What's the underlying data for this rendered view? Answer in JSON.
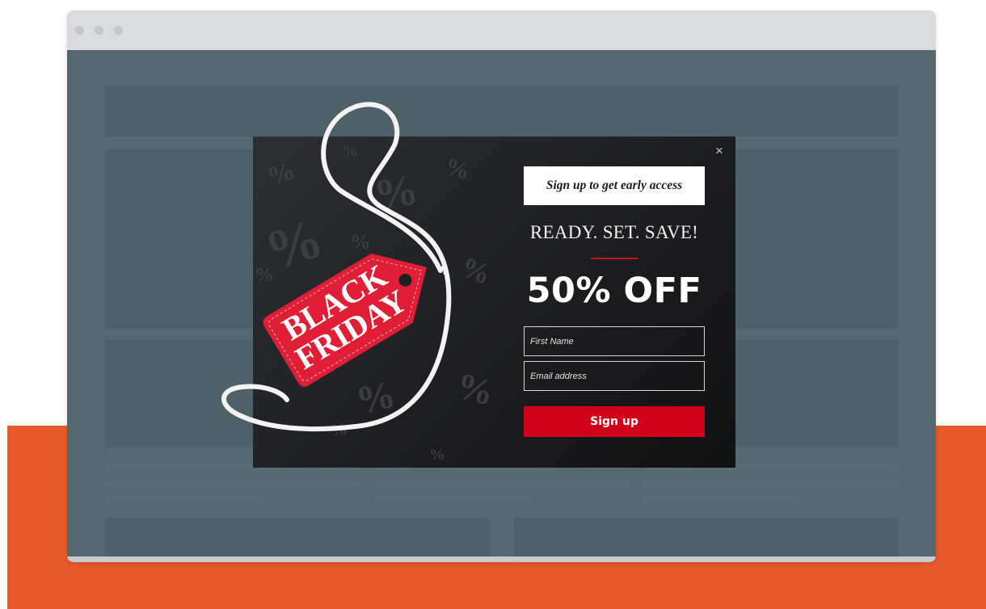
{
  "popup": {
    "heading": "Sign up to get early access",
    "tagline": "READY. SET. SAVE!",
    "offer": "50% OFF",
    "fields": {
      "first_name_placeholder": "First Name",
      "email_placeholder": "Email address"
    },
    "submit_label": "Sign up",
    "close_icon": "×",
    "tag": {
      "line1": "BLACK",
      "line2": "FRIDAY"
    },
    "pattern_glyph": "%"
  },
  "colors": {
    "accent_red": "#d0021b",
    "tag_red": "#e01f36",
    "backdrop_orange": "#e85a2a",
    "page_overlay": "#56686f"
  },
  "icons": [
    "close-icon",
    "window-dot-icon",
    "price-tag-icon",
    "percent-pattern-icon"
  ]
}
